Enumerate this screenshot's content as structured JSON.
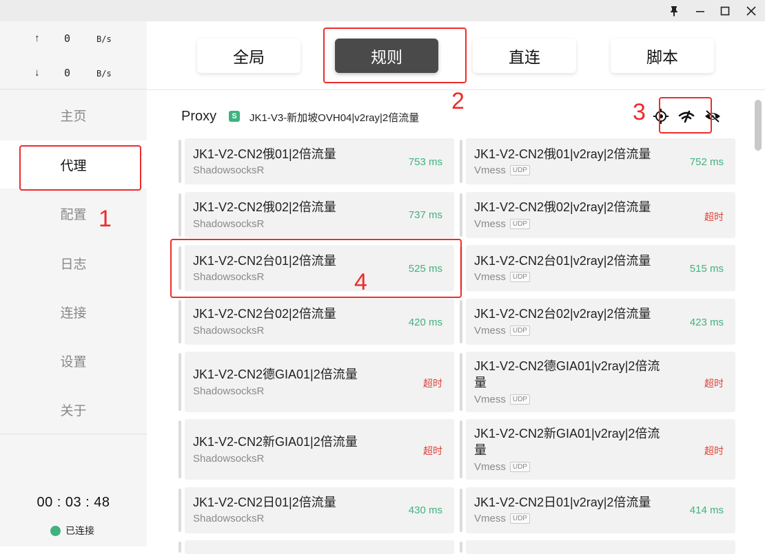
{
  "window": {
    "pin_icon": "pin-icon",
    "minimize_icon": "minimize-icon",
    "maximize_icon": "maximize-icon",
    "close_icon": "close-icon"
  },
  "sidebar": {
    "upload": {
      "arrow": "↑",
      "value": "0",
      "unit": "B/s"
    },
    "download": {
      "arrow": "↓",
      "value": "0",
      "unit": "B/s"
    },
    "items": [
      {
        "label": "主页"
      },
      {
        "label": "代理"
      },
      {
        "label": "配置"
      },
      {
        "label": "日志"
      },
      {
        "label": "连接"
      },
      {
        "label": "设置"
      },
      {
        "label": "关于"
      }
    ],
    "active_item": "代理",
    "timer": "00 : 03 : 48",
    "status": "已连接"
  },
  "modes": {
    "tabs": [
      {
        "label": "全局"
      },
      {
        "label": "规则"
      },
      {
        "label": "直连"
      },
      {
        "label": "脚本"
      }
    ],
    "active": "规则"
  },
  "proxy_group": {
    "title": "Proxy",
    "badge": "S",
    "selected": "JK1-V3-新加坡OVH04|v2ray|2倍流量",
    "icons": [
      "locate-icon",
      "latency-test-icon",
      "hide-icon"
    ]
  },
  "proxies_left": [
    {
      "name": "JK1-V2-CN2俄01|2倍流量",
      "type": "ShadowsocksR",
      "delay": "753 ms"
    },
    {
      "name": "JK1-V2-CN2俄02|2倍流量",
      "type": "ShadowsocksR",
      "delay": "737 ms"
    },
    {
      "name": "JK1-V2-CN2台01|2倍流量",
      "type": "ShadowsocksR",
      "delay": "525 ms"
    },
    {
      "name": "JK1-V2-CN2台02|2倍流量",
      "type": "ShadowsocksR",
      "delay": "420 ms"
    },
    {
      "name": "JK1-V2-CN2德GIA01|2倍流量",
      "type": "ShadowsocksR",
      "delay": "超时"
    },
    {
      "name": "JK1-V2-CN2新GIA01|2倍流量",
      "type": "ShadowsocksR",
      "delay": "超时"
    },
    {
      "name": "JK1-V2-CN2日01|2倍流量",
      "type": "ShadowsocksR",
      "delay": "430 ms"
    }
  ],
  "proxies_right": [
    {
      "name": "JK1-V2-CN2俄01|v2ray|2倍流量",
      "type": "Vmess",
      "udp": "UDP",
      "delay": "752 ms"
    },
    {
      "name": "JK1-V2-CN2俄02|v2ray|2倍流量",
      "type": "Vmess",
      "udp": "UDP",
      "delay": "超时"
    },
    {
      "name": "JK1-V2-CN2台01|v2ray|2倍流量",
      "type": "Vmess",
      "udp": "UDP",
      "delay": "515 ms"
    },
    {
      "name": "JK1-V2-CN2台02|v2ray|2倍流量",
      "type": "Vmess",
      "udp": "UDP",
      "delay": "423 ms"
    },
    {
      "name_line1": "JK1-V2-CN2德GIA01|v2ray|2倍流",
      "name_line2": "量",
      "type": "Vmess",
      "udp": "UDP",
      "delay": "超时"
    },
    {
      "name_line1": "JK1-V2-CN2新GIA01|v2ray|2倍流",
      "name_line2": "量",
      "type": "Vmess",
      "udp": "UDP",
      "delay": "超时"
    },
    {
      "name": "JK1-V2-CN2日01|v2ray|2倍流量",
      "type": "Vmess",
      "udp": "UDP",
      "delay": "414 ms"
    }
  ],
  "annotations": [
    "1",
    "2",
    "3",
    "4"
  ],
  "colors": {
    "accent_green": "#3fb27f",
    "timeout_red": "#e0433a",
    "annotation_red": "#ee2b2b",
    "active_tab": "#4a4a4a"
  }
}
